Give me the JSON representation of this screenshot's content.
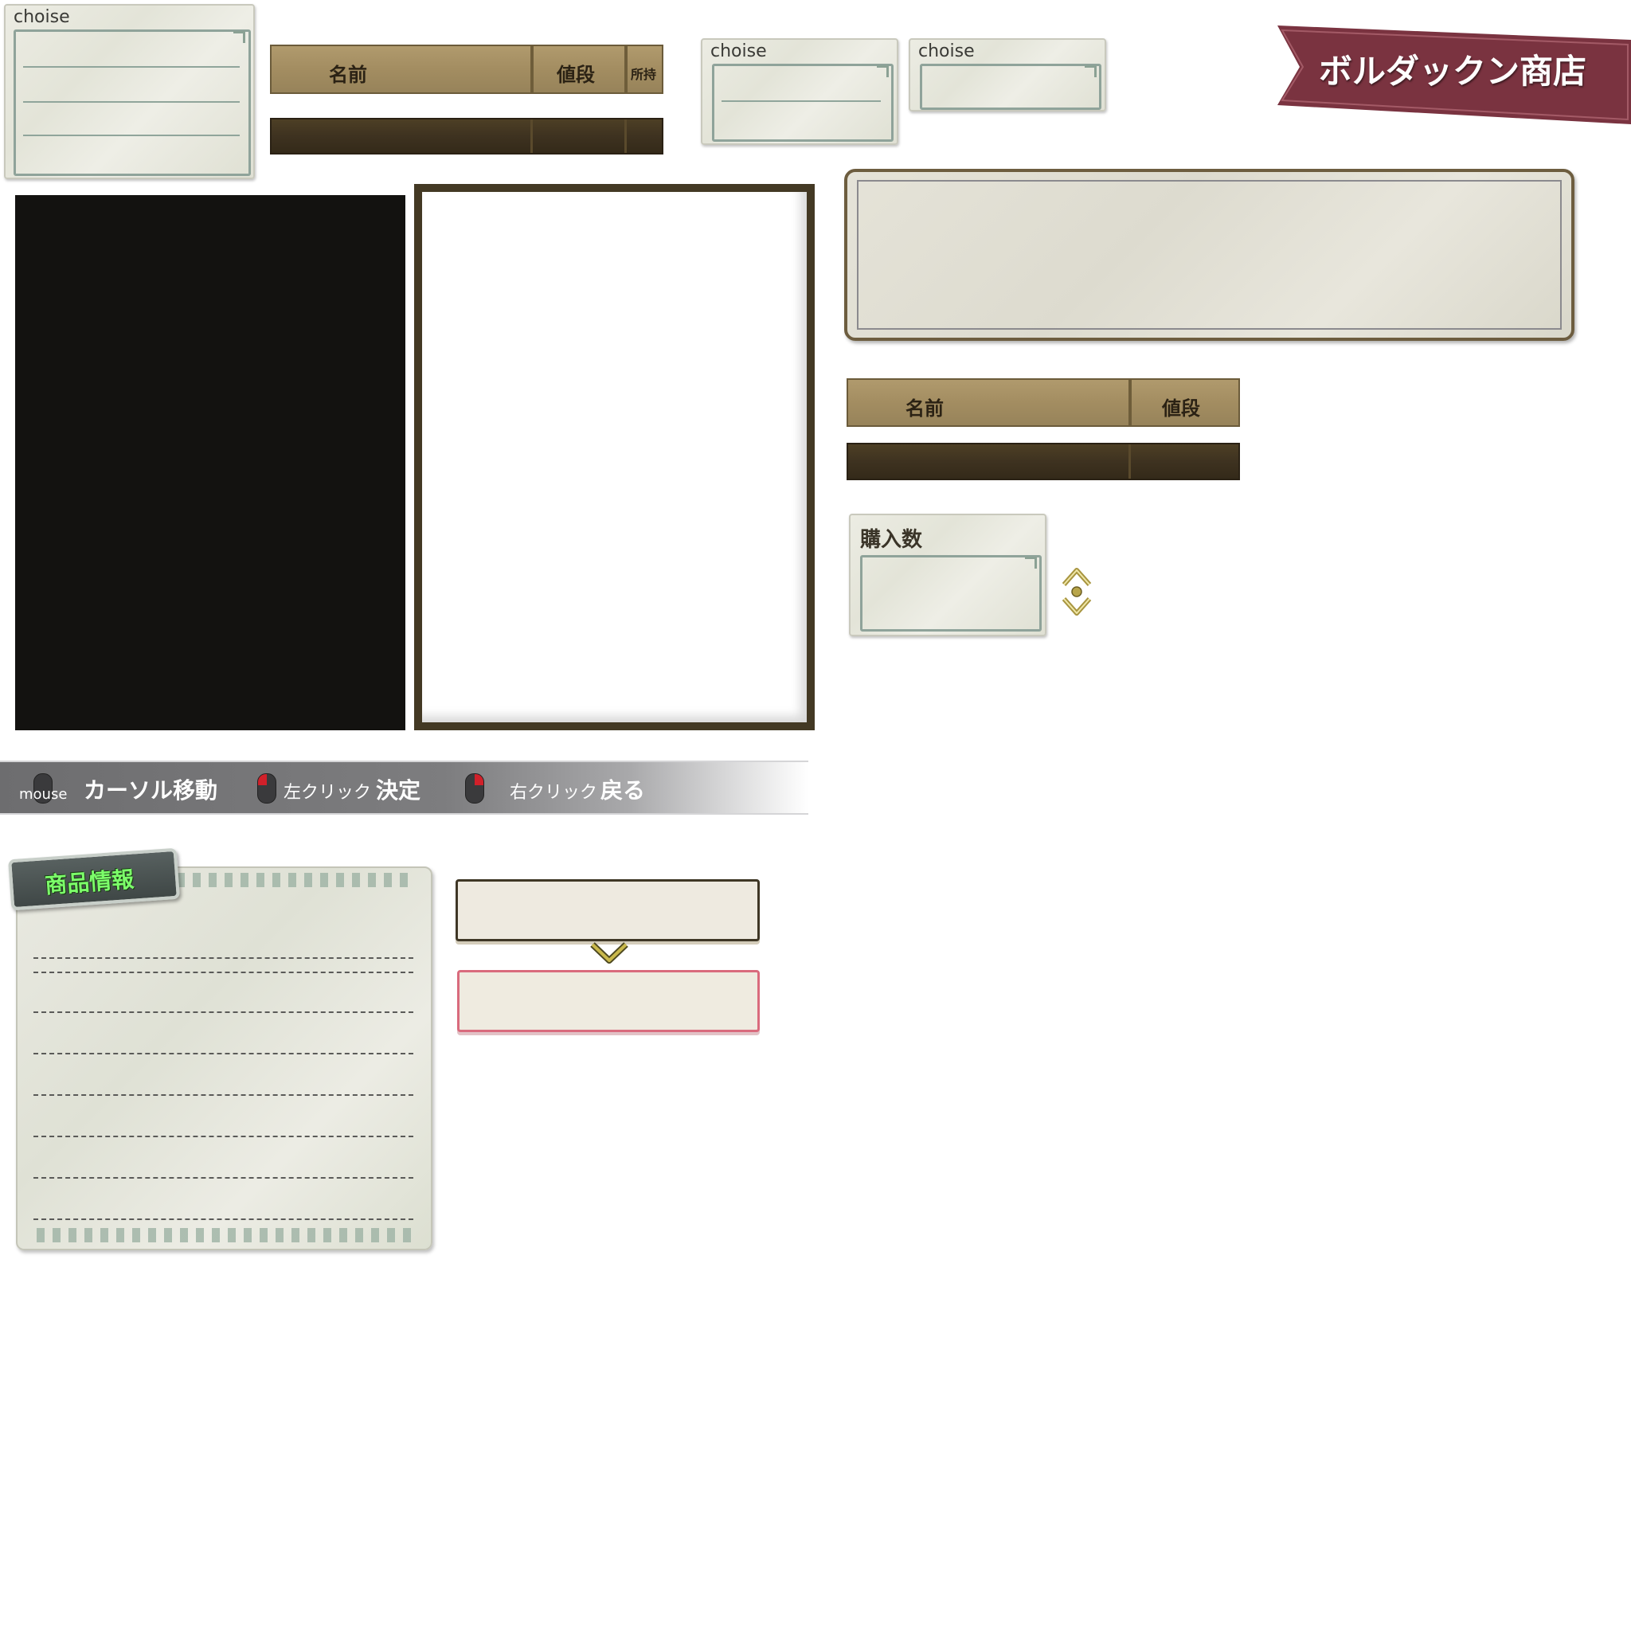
{
  "choice_boxes": [
    {
      "label": "choise"
    },
    {
      "label": "choise"
    },
    {
      "label": "choise"
    }
  ],
  "shop_table_header_full": {
    "name": "名前",
    "price": "値段",
    "owned": "所持"
  },
  "shop_table_header_short": {
    "name": "名前",
    "price": "値段"
  },
  "shop_banner": {
    "title": "ボルダックン商店"
  },
  "quantity_panel": {
    "label": "購入数"
  },
  "controls_bar": {
    "mouse_label": "mouse",
    "move_label": "カーソル移動",
    "left_click_label": "左クリック",
    "confirm_label": "決定",
    "right_click_label": "右クリック",
    "back_label": "戻る"
  },
  "item_info_panel": {
    "tab_label": "商品情報"
  },
  "colors": {
    "banner": "#7a3340",
    "wood_light": "#a38d61",
    "wood_dark": "#3e3220",
    "info_tab_text": "#7cff6a",
    "highlight_border": "#d96b7d"
  }
}
